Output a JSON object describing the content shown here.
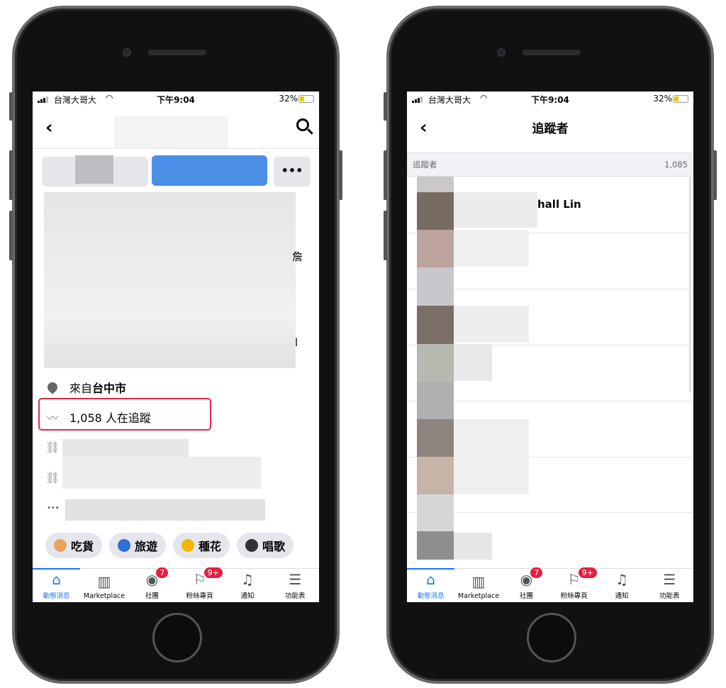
{
  "status_bar": {
    "carrier": "台灣大哥大",
    "time": "下午9:04",
    "battery": "32%"
  },
  "left": {
    "location_prefix": "來自",
    "location_city": "台中市",
    "followers_text": "1,058 人在追蹤",
    "partial_text_1": "詹",
    "partial_text_2": "l",
    "more_button": "•••",
    "interests": [
      {
        "icon": "noodle-bowl-emoji",
        "label": "吃貨",
        "color": "#e8a35c"
      },
      {
        "icon": "globe-emoji",
        "label": "旅遊",
        "color": "#2f6fd6"
      },
      {
        "icon": "sunflower-emoji",
        "label": "種花",
        "color": "#f2b705"
      },
      {
        "icon": "microphone-emoji",
        "label": "唱歌",
        "color": "#333333"
      }
    ]
  },
  "right": {
    "title": "追蹤者",
    "section_label": "追蹤者",
    "count": "1,085",
    "first_name_fragment": "hall Lin"
  },
  "tab_bar": {
    "items": [
      {
        "label": "動態消息",
        "icon": "home-icon",
        "active": true
      },
      {
        "label": "Marketplace",
        "icon": "marketplace-icon"
      },
      {
        "label": "社團",
        "icon": "groups-icon",
        "badge": "7"
      },
      {
        "label": "粉絲專頁",
        "icon": "pages-flag-icon",
        "badge": "9+"
      },
      {
        "label": "通知",
        "icon": "bell-icon"
      },
      {
        "label": "功能表",
        "icon": "menu-icon"
      }
    ]
  },
  "colors": {
    "accent": "#1877f2",
    "highlight_box": "#e0294a",
    "badge": "#e41e3f"
  }
}
